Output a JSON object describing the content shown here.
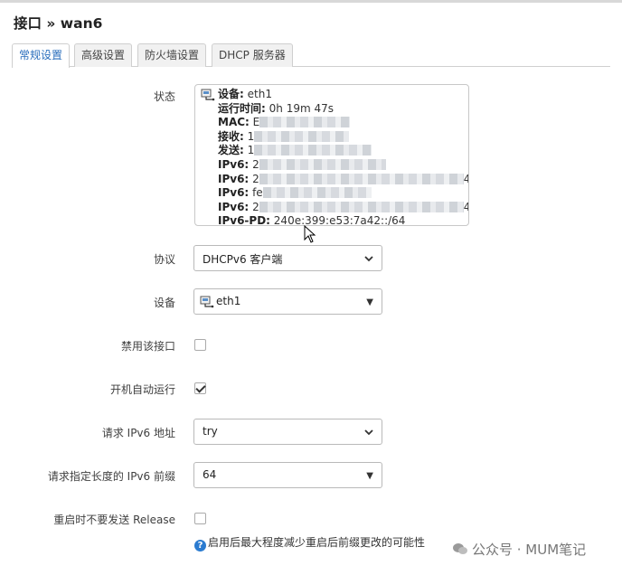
{
  "page": {
    "title": "接口 » wan6"
  },
  "tabs": [
    {
      "label": "常规设置",
      "active": true
    },
    {
      "label": "高级设置",
      "active": false
    },
    {
      "label": "防火墙设置",
      "active": false
    },
    {
      "label": "DHCP 服务器",
      "active": false
    }
  ],
  "status": {
    "label": "状态",
    "icon": "ethernet-port-icon",
    "rows": [
      {
        "key": "设备:",
        "value": "eth1"
      },
      {
        "key": "运行时间:",
        "value": "0h 19m 47s"
      },
      {
        "key": "MAC:",
        "value": "E"
      },
      {
        "key": "接收:",
        "value": "1"
      },
      {
        "key": "发送:",
        "value": "1"
      },
      {
        "key": "IPv6:",
        "value": "2"
      },
      {
        "key": "IPv6:",
        "value": "2",
        "tail": "4"
      },
      {
        "key": "IPv6:",
        "value": "fe"
      },
      {
        "key": "IPv6:",
        "value": "2",
        "tail": "4"
      },
      {
        "key": "IPv6-PD:",
        "value": "240e:399:e53:7a42::/64"
      }
    ]
  },
  "protocol": {
    "label": "协议",
    "value": "DHCPv6 客户端"
  },
  "device": {
    "label": "设备",
    "value": "eth1",
    "icon": "ethernet-port-icon"
  },
  "disable_interface": {
    "label": "禁用该接口",
    "checked": false
  },
  "auto_start": {
    "label": "开机自动运行",
    "checked": true
  },
  "request_ipv6_address": {
    "label": "请求 IPv6 地址",
    "value": "try"
  },
  "request_prefix_length": {
    "label": "请求指定长度的 IPv6 前缀",
    "value": "64"
  },
  "no_release": {
    "label": "重启时不要发送 Release",
    "checked": false,
    "help": "启用后最大程度减少重启后前缀更改的可能性"
  },
  "watermark": {
    "text": "公众号 · MUM笔记"
  },
  "colors": {
    "accent": "#2a6ebc",
    "help_icon": "#2b7bd0"
  }
}
